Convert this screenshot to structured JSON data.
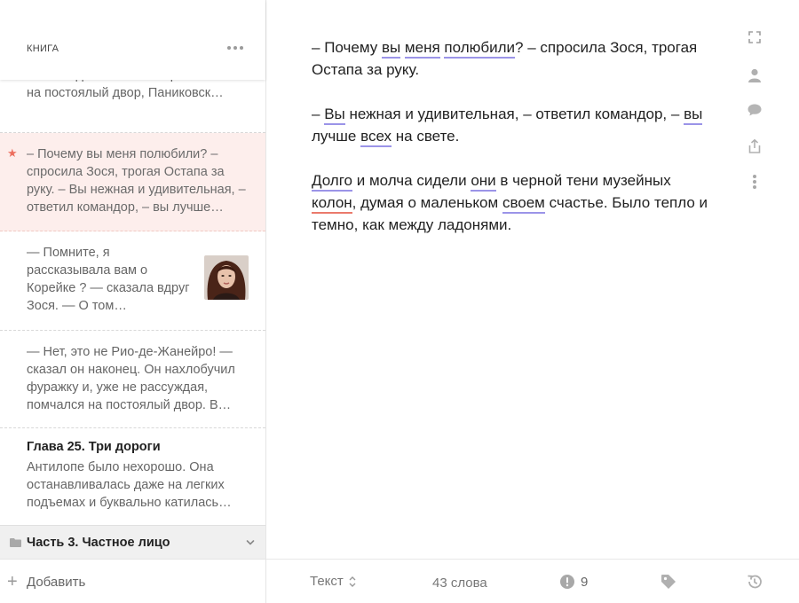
{
  "sidebar": {
    "title": "КНИГА",
    "entries": [
      {
        "text": "... последовавшие за переселением на постоялый двор, Паниковск…"
      },
      {
        "text": "– Почему вы меня полюбили? – спросила Зося, трогая Остапа за руку. – Вы нежная и удивительная, – ответил командор, – вы лучше…",
        "starred": true
      },
      {
        "text": "— Помните, я рассказывала вам о Корейке ? — сказала вдруг Зося. — О том…",
        "thumbnail": "portrait-photo"
      },
      {
        "text": "— Нет, это не Рио-де-Жанейро! — сказал он наконец. Он нахлобучил фуражку и, уже не рассуждая, помчался на постоялый двор. В…"
      },
      {
        "title": "Глава 25. Три дороги",
        "text": "Антилопе было нехорошо. Она останавливалась даже на легких подъемах и буквально катилась…"
      }
    ],
    "part": {
      "label": "Часть 3. Частное лицо",
      "icon": "folder-icon"
    },
    "add_label": "Добавить"
  },
  "editor": {
    "paragraphs": [
      "– Почему вы меня полюбили? – спросила Зося, трогая Остапа за руку.",
      "– Вы нежная и удивительная, – ответил командор, – вы лучше всех на свете.",
      "Долго и молча сидели они в черной тени музейных колон, думая о маленьком своем счастье. Было тепло и темно, как между ладонями."
    ],
    "highlighted_words": {
      "style_blue": [
        "вы",
        "меня",
        "полюбили",
        "Вы",
        "вы",
        "всех",
        "Долго",
        "они",
        "своем"
      ],
      "spelling_red": [
        "колон"
      ]
    }
  },
  "right_rail": [
    "fullscreen-icon",
    "person-icon",
    "comment-icon",
    "share-icon",
    "more-vertical-icon"
  ],
  "bottom_bar": {
    "mode_label": "Текст",
    "word_count": "43 слова",
    "issues_count": "9"
  },
  "colors": {
    "accent_star": "#ec6f5f",
    "selected_bg": "#fdeeec",
    "style_underline": "#9b94e8",
    "spelling_underline": "#ea7a6c"
  }
}
